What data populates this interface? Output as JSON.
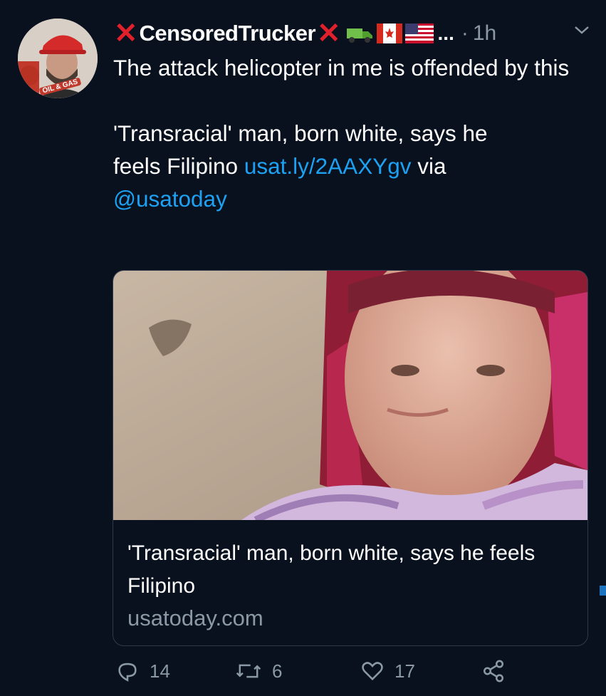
{
  "tweet": {
    "display_name": "CensoredTrucker",
    "ellipsis": "...",
    "separator": "·",
    "time": "1h",
    "text_line1": "The attack helicopter in me is offended by this",
    "text_para2_prefix": "'Transracial' man, born white, says he feels Filipino",
    "link_text": "usat.ly/2AAXYgv",
    "via_text": "via",
    "mention": "@usatoday"
  },
  "avatar": {
    "badge_text": "OIL & GAS"
  },
  "card": {
    "title": "'Transracial' man, born white, says he feels Filipino",
    "domain": "usatoday.com"
  },
  "actions": {
    "replies": "14",
    "retweets": "6",
    "likes": "17"
  },
  "colors": {
    "background": "#09111f",
    "link": "#1da1f2",
    "muted": "#8b98a5",
    "red_x": "#e0202a"
  }
}
